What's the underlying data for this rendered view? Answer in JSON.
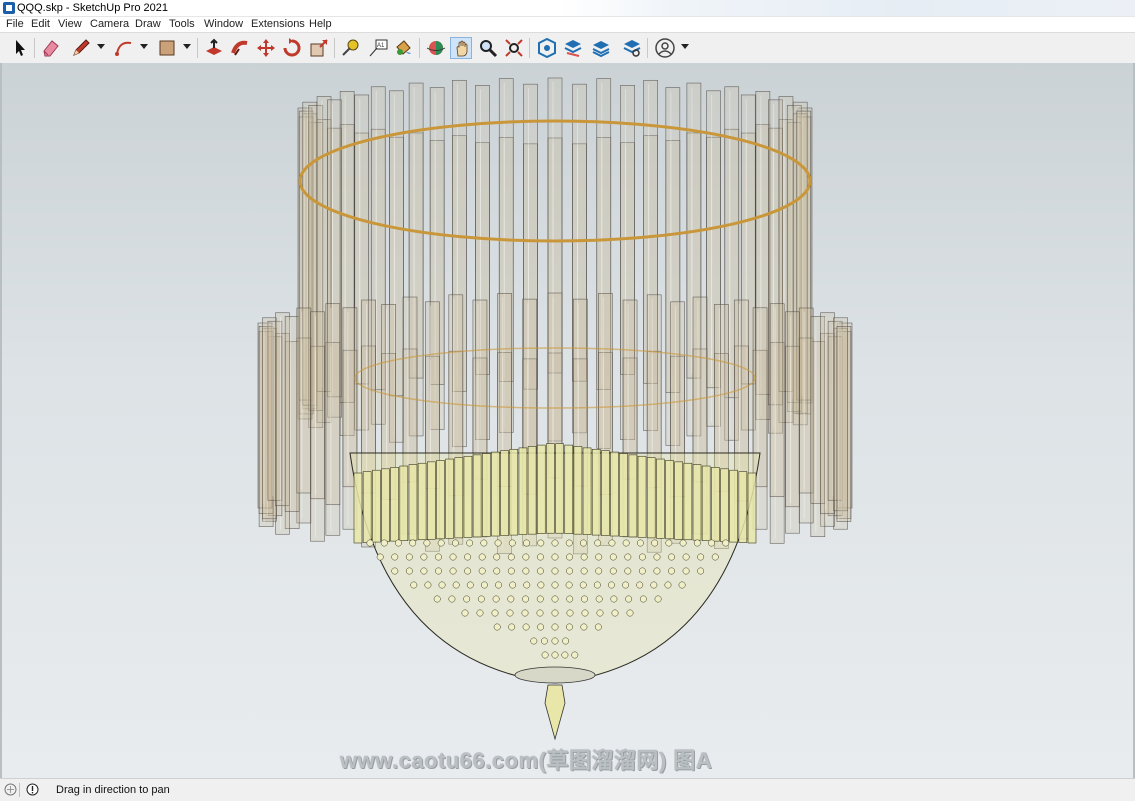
{
  "window": {
    "title": "QQQ.skp - SketchUp Pro 2021"
  },
  "menu": [
    "File",
    "Edit",
    "View",
    "Camera",
    "Draw",
    "Tools",
    "Window",
    "Extensions",
    "Help"
  ],
  "toolbar": {
    "tools": [
      "select-icon",
      "eraser-icon",
      "pencil-line-icon",
      "arc-icon",
      "rectangle-icon",
      "push-pull-icon",
      "follow-me-icon",
      "move-icon",
      "rotate-icon",
      "scale-icon",
      "tape-measure-icon",
      "text-icon",
      "paint-bucket-icon",
      "orbit-icon",
      "pan-icon",
      "zoom-icon",
      "zoom-extents-icon",
      "warehouse-icon",
      "extension-warehouse-icon",
      "layout-icon",
      "extension-manager-icon",
      "account-icon"
    ],
    "active_tool": "pan-icon"
  },
  "viewport": {
    "watermark": "www.caotu66.com(草图溜溜网) 图A"
  },
  "status": {
    "hint": "Drag in direction to pan"
  },
  "colors": {
    "accent": "#8ab4de",
    "glass": "#c9b99a",
    "crystal": "#e8e6a8",
    "ring": "#c9973a"
  }
}
